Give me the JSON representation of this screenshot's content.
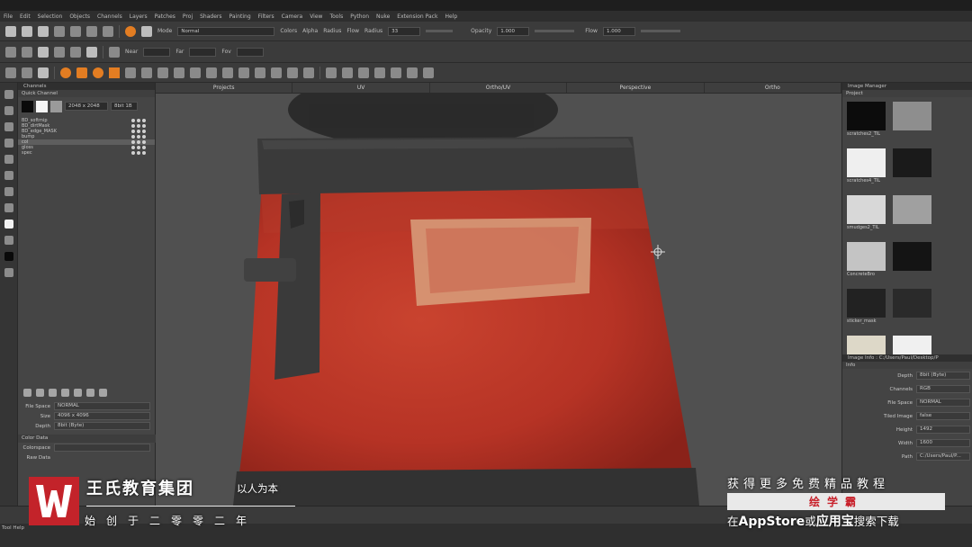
{
  "menu": [
    "File",
    "Edit",
    "Selection",
    "Objects",
    "Channels",
    "Layers",
    "Patches",
    "Proj",
    "Shaders",
    "Painting",
    "Filters",
    "Camera",
    "View",
    "Tools",
    "Python",
    "Nuke",
    "Extension Pack",
    "Help"
  ],
  "toolbar1": {
    "mode_label": "Mode",
    "mode_value": "Normal",
    "colors_label": "Colors",
    "alpha_label": "Alpha",
    "radius_label": "Radius",
    "flow_label": "Flow",
    "radius_field_label": "Radius",
    "radius_value": "33",
    "opacity_label": "Opacity",
    "opacity_value": "1.000",
    "flow_field_label": "Flow",
    "flow_value": "1.000"
  },
  "toolbar2": {
    "near_label": "Near",
    "far_label": "Far",
    "fov_label": "Fov"
  },
  "channels": {
    "title": "Channels",
    "quick_channel": "Quick Channel",
    "size_value": "2048 x 2048",
    "depth_value": "8bit 1B",
    "items": [
      {
        "name": "BD_softmip",
        "selected": false
      },
      {
        "name": "BD_dirtMask",
        "selected": false
      },
      {
        "name": "BD_edge_MASK",
        "selected": false
      },
      {
        "name": "bump",
        "selected": false
      },
      {
        "name": "col",
        "selected": true
      },
      {
        "name": "gloss",
        "selected": false
      },
      {
        "name": "spec",
        "selected": false
      }
    ],
    "info": {
      "file_space_label": "File Space",
      "file_space_value": "NORMAL",
      "size_label": "Size",
      "size_value": "4096 x 4096",
      "depth_label": "Depth",
      "depth_value": "8bit (Byte)",
      "color_data_label": "Color Data",
      "colorspace_label": "Colorspace",
      "raw_data_label": "Raw Data"
    }
  },
  "view_tabs": [
    "Projects",
    "UV",
    "Ortho/UV",
    "Perspective",
    "Ortho"
  ],
  "image_manager": {
    "title": "Image Manager",
    "project_label": "Project",
    "thumbs": [
      {
        "caption": "scratches2_TIL",
        "color": "#0c0c0c"
      },
      {
        "caption": "scratches3_TIL",
        "color": "#8e8e8e"
      },
      {
        "caption": "scratches4_TIL",
        "color": "#efefef"
      },
      {
        "caption": "smudges_TIL",
        "color": "#1a1a1a"
      },
      {
        "caption": "smudges2_TIL",
        "color": "#d8d8d8"
      },
      {
        "caption": "FlakedGRPHGN",
        "color": "#a0a0a0"
      },
      {
        "caption": "ConcreteBro",
        "color": "#c4c4c4"
      },
      {
        "caption": "Scratch_MAIN",
        "color": "#141414"
      },
      {
        "caption": "sticker_mask",
        "color": "#222222"
      },
      {
        "caption": "sticker.jpg",
        "color": "#2a2a2a"
      },
      {
        "caption": "",
        "color": "#ddd8c8"
      },
      {
        "caption": "",
        "color": "#f0f0f0"
      }
    ],
    "image_info_label": "Image Info : C:/Users/Paul/Desktop/P",
    "info_label": "Info",
    "depth_label": "Depth",
    "depth_value": "8bit (Byte)",
    "channels_label": "Channels",
    "channels_value": "RGB",
    "file_space_label": "File Space",
    "file_space_value": "NORMAL",
    "tiled_label": "Tiled Image",
    "tiled_value": "false",
    "height_label": "Height",
    "height_value": "1492",
    "width_label": "Width",
    "width_value": "1600",
    "path_label": "Path",
    "path_value": "C:/Users/Paul/P..."
  },
  "status": {
    "tool_help": "Tool Help"
  },
  "watermark": {
    "company": "王氏教育集团",
    "slogan": "以人为本",
    "founded": "始创于二零零二年",
    "promo": "获得更多免费精品教程",
    "brand": "绘学霸",
    "store_prefix": "在",
    "store_app": "AppStore",
    "store_mid": "或",
    "store_yyb": "应用宝",
    "store_suffix": "搜索下载"
  },
  "colors": {
    "object_red": "#c2382a",
    "object_dark": "#333333",
    "watermark_red": "#c3232a"
  }
}
